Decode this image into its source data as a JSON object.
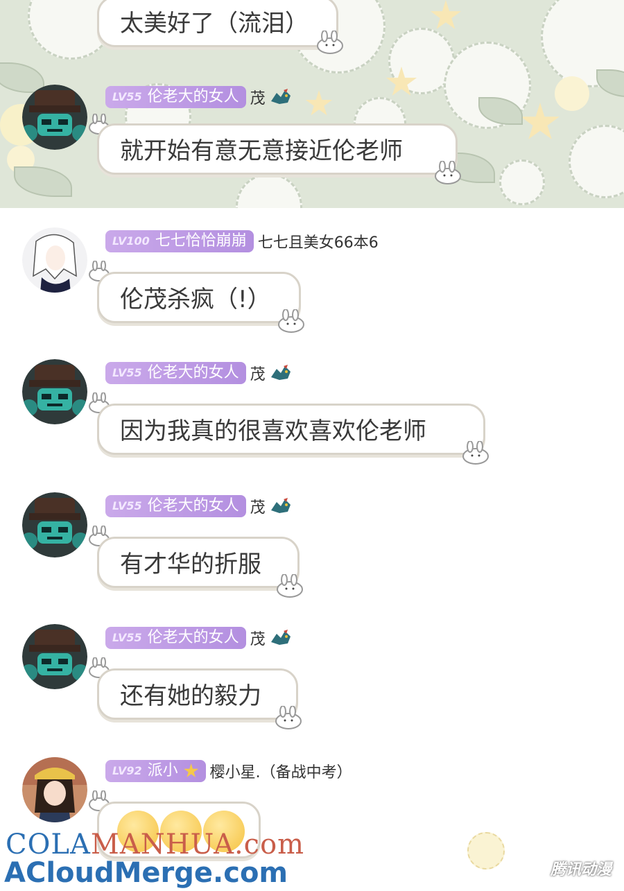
{
  "messages": [
    {
      "text": "太美好了（流泪）"
    },
    {
      "level": "LV55",
      "name": "伦老大的女人",
      "nickname": "茂",
      "text": "就开始有意无意接近伦老师"
    },
    {
      "level": "LV100",
      "name": "七七恰恰崩崩",
      "nickname": "七七且美女66本6",
      "text": "伦茂杀疯（!）"
    },
    {
      "level": "LV55",
      "name": "伦老大的女人",
      "nickname": "茂",
      "text": "因为我真的很喜欢喜欢伦老师"
    },
    {
      "level": "LV55",
      "name": "伦老大的女人",
      "nickname": "茂",
      "text": "有才华的折服"
    },
    {
      "level": "LV55",
      "name": "伦老大的女人",
      "nickname": "茂",
      "text": "还有她的毅力"
    },
    {
      "level": "LV92",
      "name": "派小",
      "nickname": "樱小星.（备战中考）",
      "text": ""
    }
  ],
  "watermarks": {
    "cola": "COLA",
    "manhua": "MANHUA.com",
    "acloud": "ACloudMerge.com",
    "tencent": "腾讯动漫"
  },
  "colors": {
    "badge": "#b38fe0",
    "bubble_border": "#d8d3c9",
    "background_top": "#dfe6d8"
  },
  "icons": [
    "bunny-icon",
    "dragon-icon",
    "star-icon",
    "laughing-face-icon"
  ]
}
